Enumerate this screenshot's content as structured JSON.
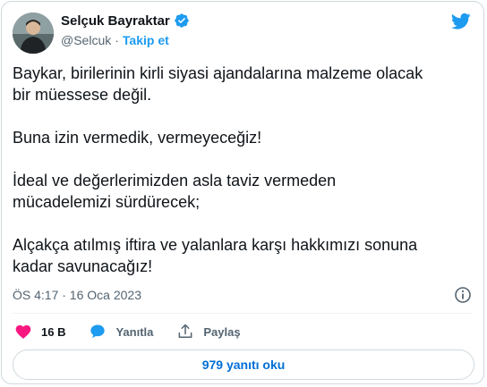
{
  "author": {
    "name": "Selçuk Bayraktar",
    "handle": "@Selcuk",
    "separator": "·",
    "follow_label": "Takip et"
  },
  "tweet": {
    "paragraphs": [
      "Baykar, birilerinin kirli siyasi ajandalarına malzeme olacak\nbir müessese değil.",
      "Buna izin vermedik, vermeyeceğiz!",
      "İdeal ve değerlerimizden asla taviz vermeden\nmücadelemizi sürdürecek;",
      "Alçakça atılmış iftira ve yalanlara karşı hakkımızı sonuna\nkadar savunacağız!"
    ],
    "timestamp": "ÖS 4:17 · 16 Oca 2023"
  },
  "actions": {
    "like_count": "16 B",
    "reply_label": "Yanıtla",
    "share_label": "Paylaş"
  },
  "replies_button": "979 yanıtı oku",
  "colors": {
    "accent": "#1d9bf0",
    "like": "#f91880",
    "link_blue": "#006fd6"
  },
  "icons": [
    "verified-badge-icon",
    "twitter-bird-icon",
    "info-icon",
    "heart-icon",
    "reply-bubble-icon",
    "share-icon"
  ]
}
